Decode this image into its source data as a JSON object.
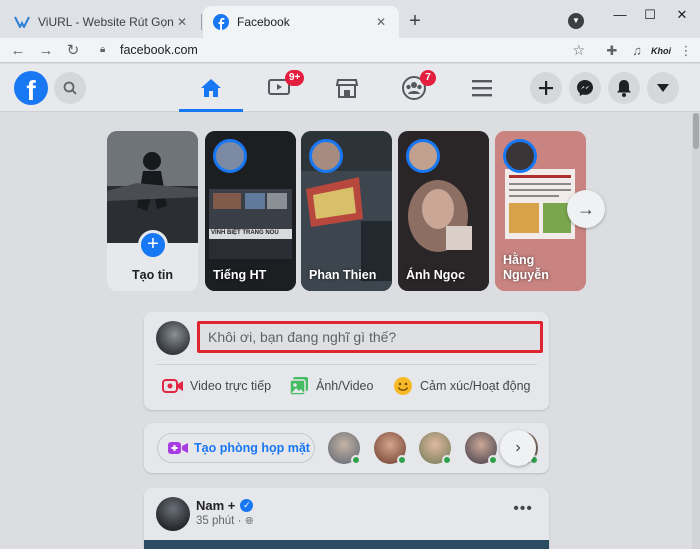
{
  "browser": {
    "tabs": [
      {
        "title": "ViURL - Website Rút Gọn Link Miễn Phí",
        "active": false
      },
      {
        "title": "Facebook",
        "active": true
      }
    ],
    "new_tab_label": "+",
    "address": "facebook.com",
    "extension_user_label": "Khoi"
  },
  "facebook": {
    "nav_badges": {
      "watch": "9+",
      "groups": "7"
    },
    "stories": {
      "create_label": "Tạo tin",
      "items": [
        {
          "name": "Tiếng HT"
        },
        {
          "name": "Phan Thien"
        },
        {
          "name": "Ánh Ngọc"
        },
        {
          "name": "Hằng Nguyễn"
        }
      ],
      "story_thumb_text": "VĨNH BIỆT TRĂNG NOU"
    },
    "composer": {
      "placeholder": "Khôi ơi, bạn đang nghĩ gì thế?",
      "actions": [
        {
          "label": "Video trực tiếp"
        },
        {
          "label": "Ảnh/Video"
        },
        {
          "label": "Cảm xúc/Hoạt động"
        }
      ]
    },
    "rooms": {
      "create_label": "Tạo phòng họp mặt"
    },
    "post": {
      "author": "Nam +",
      "time": "35 phút ·"
    }
  },
  "colors": {
    "fb_blue": "#1877f2",
    "highlight_red": "#e0242f",
    "badge_red": "#e41e3f",
    "online_green": "#31a24c"
  }
}
